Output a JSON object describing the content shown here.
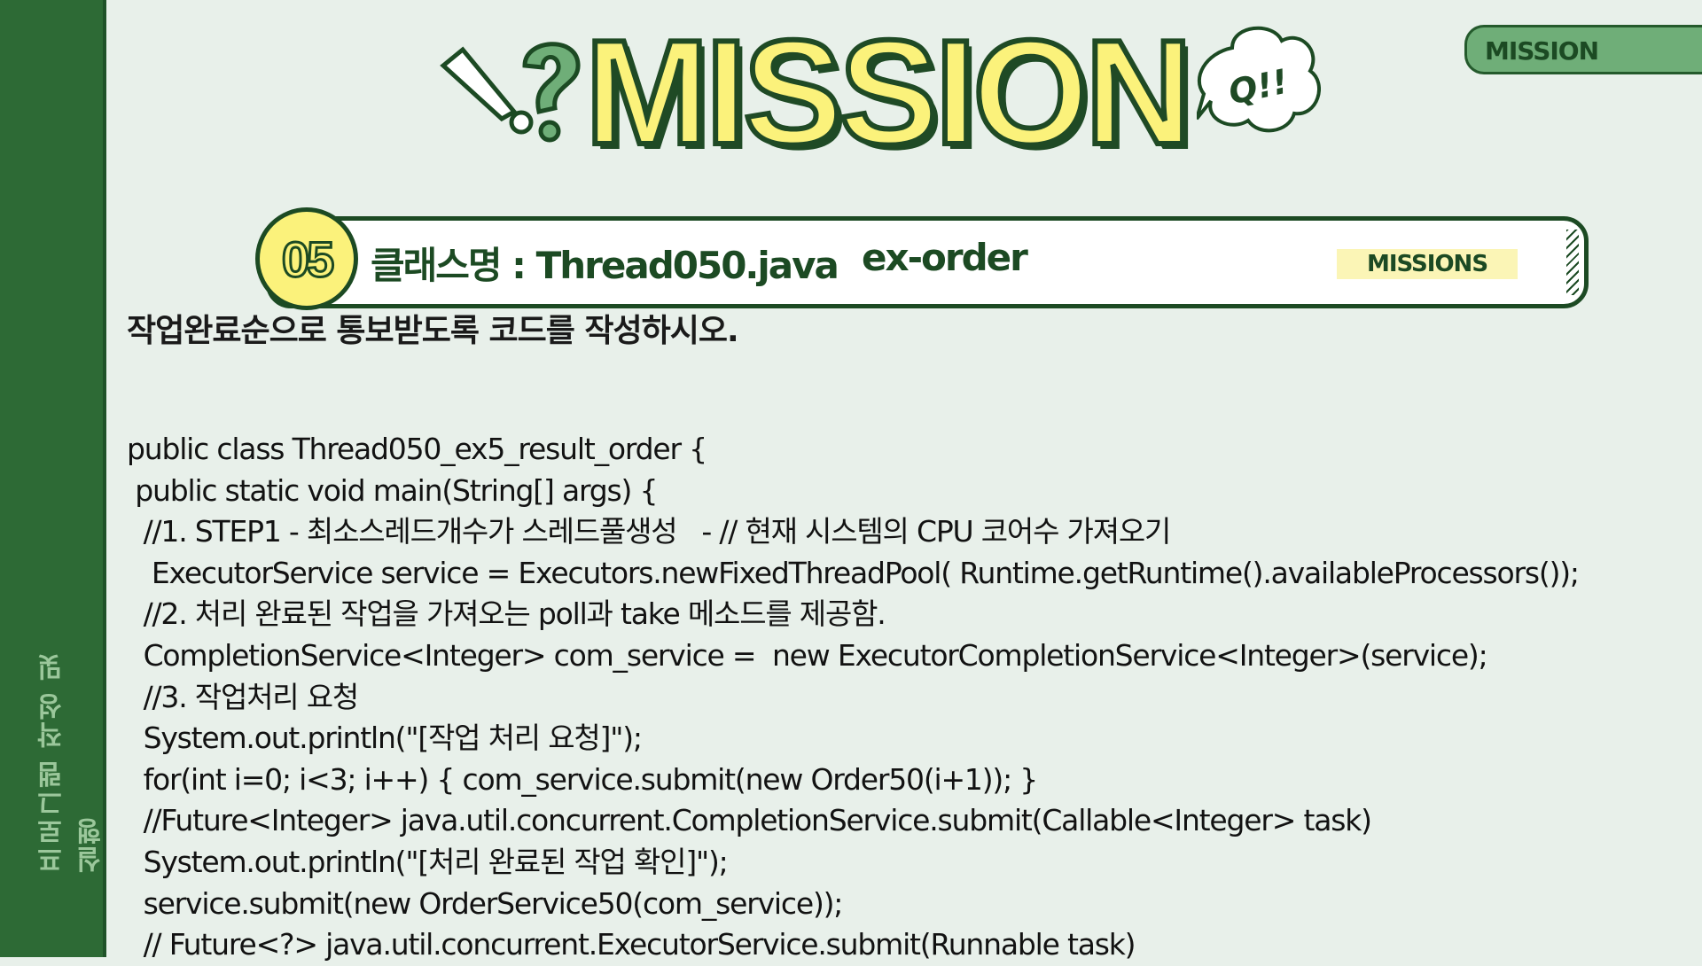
{
  "sidebar": {
    "label": "프로그램 작성 및 실행"
  },
  "tab": {
    "label": "MISSION"
  },
  "hero": {
    "title": "MISSION",
    "bubble_text": "Q!!"
  },
  "banner": {
    "number": "05",
    "class_label": "클래스명 : Thread050.java",
    "subtitle": "ex-order",
    "tag": "MISSIONS"
  },
  "instruction": "작업완료순으로 통보받도록 코드를 작성하시오.",
  "code_lines": [
    "public class Thread050_ex5_result_order {",
    " public static void main(String[] args) {",
    "  //1. STEP1 - 최소스레드개수가 스레드풀생성   - // 현재 시스템의 CPU 코어수 가져오기",
    "   ExecutorService service = Executors.newFixedThreadPool( Runtime.getRuntime().availableProcessors());",
    "  //2. 처리 완료된 작업을 가져오는 poll과 take 메소드를 제공함.",
    "  CompletionService<Integer> com_service =  new ExecutorCompletionService<Integer>(service);",
    "  //3. 작업처리 요청",
    "  System.out.println(\"[작업 처리 요청]\");",
    "  for(int i=0; i<3; i++) { com_service.submit(new Order50(i+1)); }",
    "  //Future<Integer> java.util.concurrent.CompletionService.submit(Callable<Integer> task)",
    "  System.out.println(\"[처리 완료된 작업 확인]\");",
    "  service.submit(new OrderService50(com_service));",
    "  // Future<?> java.util.concurrent.ExecutorService.submit(Runnable task)"
  ],
  "colors": {
    "sidebar": "#2d6a35",
    "background": "#e8f0ea",
    "accent_yellow": "#fbf27b",
    "dark_green": "#1c4a23"
  }
}
